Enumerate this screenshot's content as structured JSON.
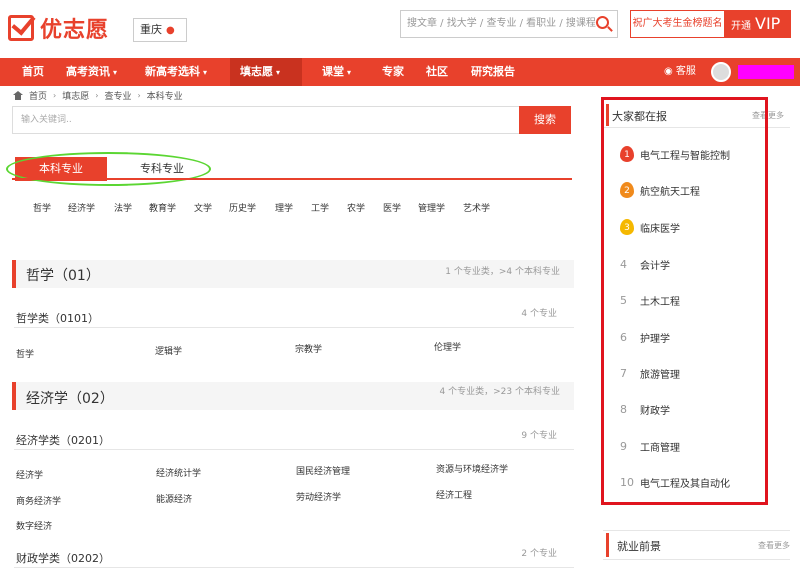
{
  "header": {
    "logo_text": "优志愿",
    "city": "重庆",
    "search_placeholder": "搜文章 / 找大学 / 查专业 / 看职业 / 搜课程",
    "promo": "祝广大考生金榜题名",
    "vip_prefix": "开通",
    "vip_label": "VIP"
  },
  "nav": {
    "items": [
      {
        "label": "首页"
      },
      {
        "label": "高考资讯"
      },
      {
        "label": "新高考选科"
      },
      {
        "label": "填志愿"
      },
      {
        "label": "课堂"
      },
      {
        "label": "专家"
      },
      {
        "label": "社区"
      },
      {
        "label": "研究报告"
      }
    ],
    "kefu": "客服"
  },
  "breadcrumb": [
    "首页",
    "填志愿",
    "查专业",
    "本科专业"
  ],
  "keyword": {
    "placeholder": "输入关键词..",
    "button": "搜索"
  },
  "tabs": {
    "active": "本科专业",
    "other": "专科专业"
  },
  "disciplines": [
    "哲学",
    "经济学",
    "法学",
    "教育学",
    "文学",
    "历史学",
    "理学",
    "工学",
    "农学",
    "医学",
    "管理学",
    "艺术学"
  ],
  "sections": [
    {
      "title": "哲学（01）",
      "meta": "1 个专业类，>4 个本科专业",
      "subs": [
        {
          "title": "哲学类（0101）",
          "meta": "4 个专业",
          "majors": [
            "哲学",
            "逻辑学",
            "宗教学",
            "伦理学"
          ]
        }
      ]
    },
    {
      "title": "经济学（02）",
      "meta": "4 个专业类，>23 个本科专业",
      "subs": [
        {
          "title": "经济学类（0201）",
          "meta": "9 个专业",
          "majors": [
            "经济学",
            "经济统计学",
            "国民经济管理",
            "资源与环境经济学",
            "商务经济学",
            "能源经济",
            "劳动经济学",
            "经济工程",
            "数字经济"
          ]
        },
        {
          "title": "财政学类（0202）",
          "meta": "2 个专业",
          "majors": []
        }
      ]
    }
  ],
  "sidebar": {
    "title": "大家都在报",
    "more": "查看更多",
    "ranks": [
      {
        "num": "1",
        "name": "电气工程与智能控制"
      },
      {
        "num": "2",
        "name": "航空航天工程"
      },
      {
        "num": "3",
        "name": "临床医学"
      },
      {
        "num": "4",
        "name": "会计学"
      },
      {
        "num": "5",
        "name": "土木工程"
      },
      {
        "num": "6",
        "name": "护理学"
      },
      {
        "num": "7",
        "name": "旅游管理"
      },
      {
        "num": "8",
        "name": "财政学"
      },
      {
        "num": "9",
        "name": "工商管理"
      },
      {
        "num": "10",
        "name": "电气工程及其自动化"
      }
    ],
    "job_title": "就业前景",
    "job_more": "查看更多"
  },
  "colors": {
    "accent": "#e8412c",
    "highlight_box": "#e0141e",
    "tab_ellipse": "#5bd632",
    "masked_user": "#ff00ff"
  }
}
